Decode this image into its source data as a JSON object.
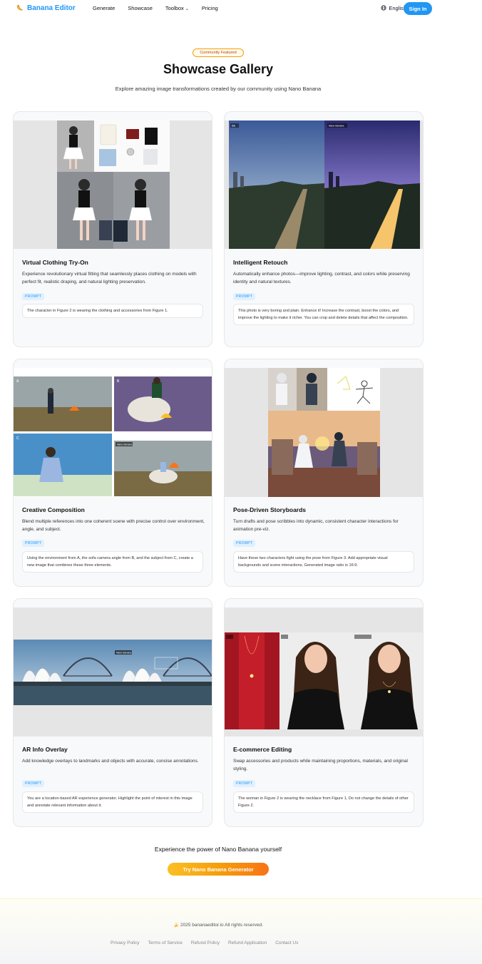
{
  "nav": {
    "brand": "Banana Editor",
    "links": [
      "Generate",
      "Showcase",
      "Toolbox",
      "Pricing"
    ],
    "language": "English",
    "signin": "Sign In"
  },
  "hero": {
    "badge": "Community Featured",
    "title": "Showcase Gallery",
    "subtitle": "Explore amazing image transformations created by our community using Nano Banana"
  },
  "cards": [
    {
      "title": "Virtual Clothing Try-On",
      "desc": "Experience revolutionary virtual fitting that seamlessly places clothing on models with perfect fit, realistic draping, and natural lighting preservation.",
      "tag": "PROMPT",
      "prompt": "The character in Figure 2 is wearing the clothing and accessories from Figure 1."
    },
    {
      "title": "Intelligent Retouch",
      "desc": "Automatically enhance photos—improve lighting, contrast, and colors while preserving identity and natural textures.",
      "tag": "PROMPT",
      "prompt": "This photo is very boring and plain. Enhance it! Increase the contrast, boost the colors, and improve the lighting to make it richer. You can crop and delete details that affect the composition."
    },
    {
      "title": "Creative Composition",
      "desc": "Blend multiple references into one coherent scene with precise control over environment, angle, and subject.",
      "tag": "PROMPT",
      "prompt": "Using the environment from A, the sofa camera angle from B, and the subject from C, create a new image that combines these three elements."
    },
    {
      "title": "Pose-Driven Storyboards",
      "desc": "Turn drafts and pose scribbles into dynamic, consistent character interactions for animation pre-viz.",
      "tag": "PROMPT",
      "prompt": "Have these two characters fight using the pose from Figure 3. Add appropriate visual backgrounds and scene interactions, Generated image ratio is 16:9."
    },
    {
      "title": "AR Info Overlay",
      "desc": "Add knowledge overlays to landmarks and objects with accurate, concise annotations.",
      "tag": "PROMPT",
      "prompt": "You are a location-based AR experience generator. Highlight the point of interest in this image and annotate relevant information about it."
    },
    {
      "title": "E-commerce Editing",
      "desc": "Swap accessories and products while maintaining proportions, materials, and original styling.",
      "tag": "PROMPT",
      "prompt": "The woman in Figure 2 is wearing the necklace from Figure 1, Do not change the details of other Figure 2."
    }
  ],
  "image_labels": {
    "before": "Before",
    "after": "Nano Banana",
    "a": "A",
    "b": "B",
    "c": "C",
    "ar_label": "Nano Banana"
  },
  "cta": {
    "text": "Experience the power of Nano Banana yourself",
    "button": "Try Nano Banana Generator"
  },
  "footer": {
    "copyright": "2025 bananaeditor.io All rights reserved.",
    "links": [
      "Privacy Policy",
      "Terms of Service",
      "Refund Policy",
      "Refund Application",
      "Contact Us"
    ]
  },
  "colors": {
    "brand": "#2196f3",
    "accent": "#f59e0b"
  }
}
